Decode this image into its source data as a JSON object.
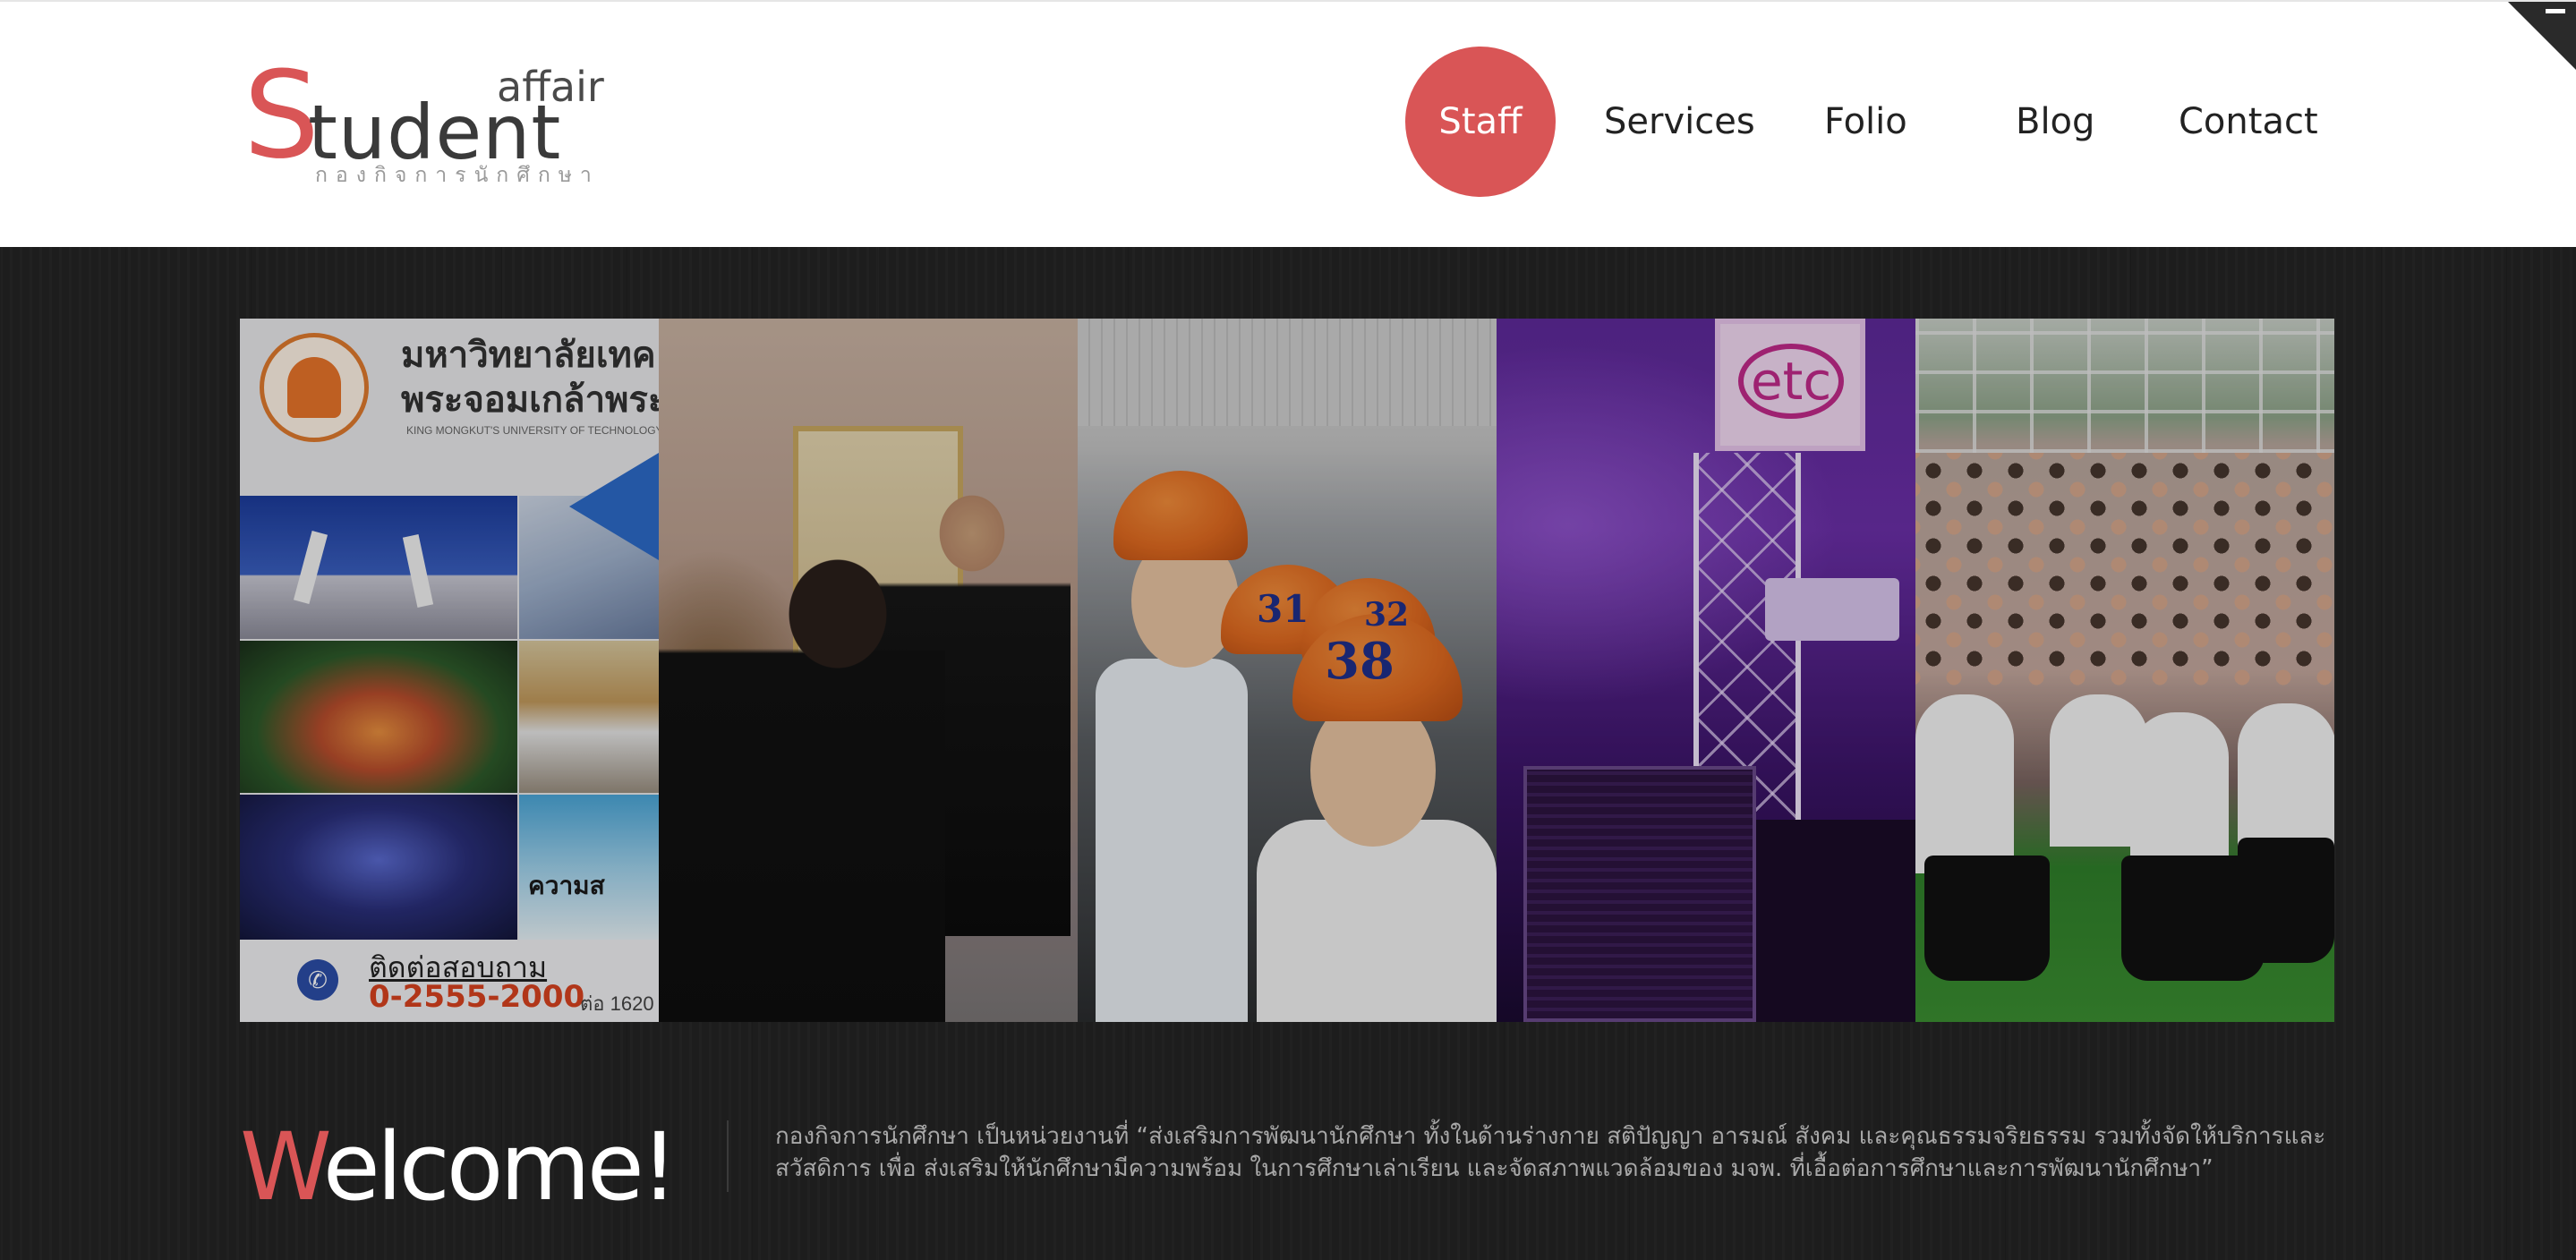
{
  "header": {
    "logo": {
      "letter_s": "S",
      "word_tudent": "tudent",
      "word_affair": "affair",
      "thai_subtitle": "กองกิจการนักศึกษา"
    },
    "nav": [
      {
        "label": "Staff",
        "active": true
      },
      {
        "label": "Services",
        "active": false
      },
      {
        "label": "Folio",
        "active": false
      },
      {
        "label": "Blog",
        "active": false
      },
      {
        "label": "Contact",
        "active": false
      }
    ]
  },
  "gallery": {
    "panels": [
      {
        "name": "poster",
        "university_name_line1": "มหาวิทยาลัยเทค",
        "university_name_line2": "พระจอมเกล้าพระน",
        "university_name_en": "KING MONGKUT'S UNIVERSITY OF TECHNOLOGY",
        "inset_text": "ความส",
        "contact_label": "ติดต่อสอบถาม",
        "contact_number": "0-2555-2000",
        "contact_ext": "ต่อ 1620"
      },
      {
        "name": "meeting"
      },
      {
        "name": "helmets",
        "helmet_numbers": [
          "31",
          "32",
          "38"
        ]
      },
      {
        "name": "concert",
        "sign_text": "etc"
      },
      {
        "name": "crowd"
      }
    ]
  },
  "welcome": {
    "first_letter": "W",
    "rest": "elcome!",
    "text": "กองกิจการนักศึกษา เป็นหน่วยงานที่ “ส่งเสริมการพัฒนานักศึกษา ทั้งในด้านร่างกาย สติปัญญา อารมณ์ สังคม และคุณธรรมจริยธรรม รวมทั้งจัดให้บริการและสวัสดิการ เพื่อ ส่งเสริมให้นักศึกษามีความพร้อม ในการศึกษาเล่าเรียน และจัดสภาพแวดล้อมของ มจพ. ที่เอื้อต่อการศึกษาและการพัฒนานักศึกษา”"
  },
  "colors": {
    "accent": "#d95556",
    "dark_bg": "#1d1d1d",
    "header_bg": "#ffffff"
  },
  "icons": {
    "phone": "phone-icon",
    "corner": "corner-ribbon-icon"
  }
}
